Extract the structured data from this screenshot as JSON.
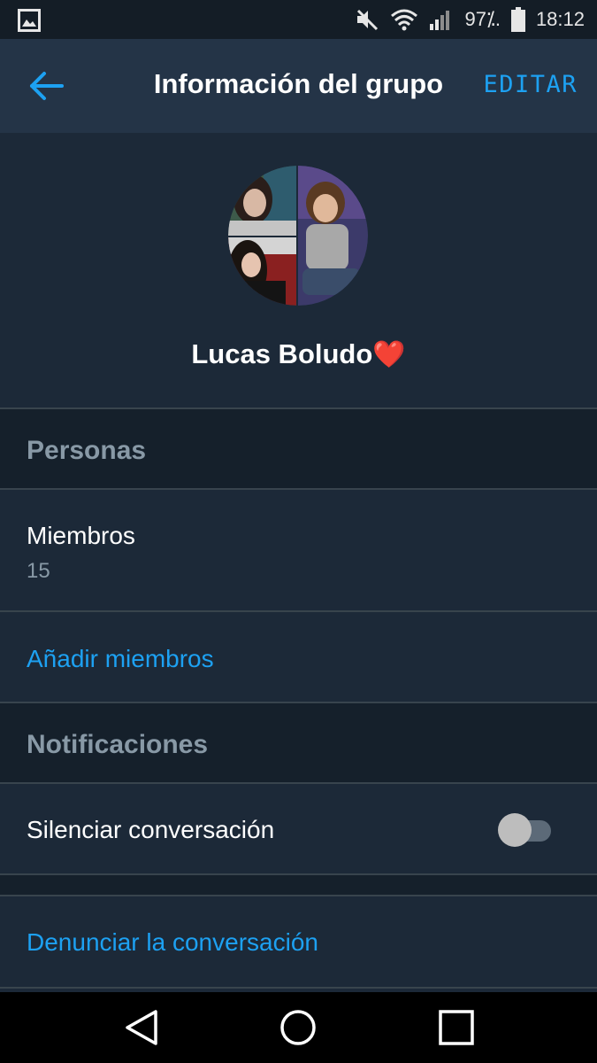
{
  "status_bar": {
    "battery": "97⁒.",
    "time": "18:12",
    "icons": [
      "image-icon",
      "muted-icon",
      "wifi-icon",
      "signal-icon",
      "battery-icon"
    ]
  },
  "app_bar": {
    "title": "Información del grupo",
    "edit_label": "EDITAR",
    "back_icon": "arrow-left-icon"
  },
  "group": {
    "name": "Lucas Boludo",
    "emoji": "❤️"
  },
  "sections": {
    "people": "Personas",
    "notifications": "Notificaciones"
  },
  "members": {
    "label": "Miembros",
    "count": "15"
  },
  "add_members_label": "Añadir miembros",
  "mute": {
    "label": "Silenciar conversación",
    "enabled": false
  },
  "report_label": "Denunciar la conversación",
  "colors": {
    "accent": "#1da1f2",
    "background": "#1c2938",
    "section_background": "#15202b",
    "appbar": "#243447",
    "heart": "#e0245e"
  },
  "nav_bar": [
    "back-triangle-icon",
    "home-circle-icon",
    "recents-square-icon"
  ]
}
